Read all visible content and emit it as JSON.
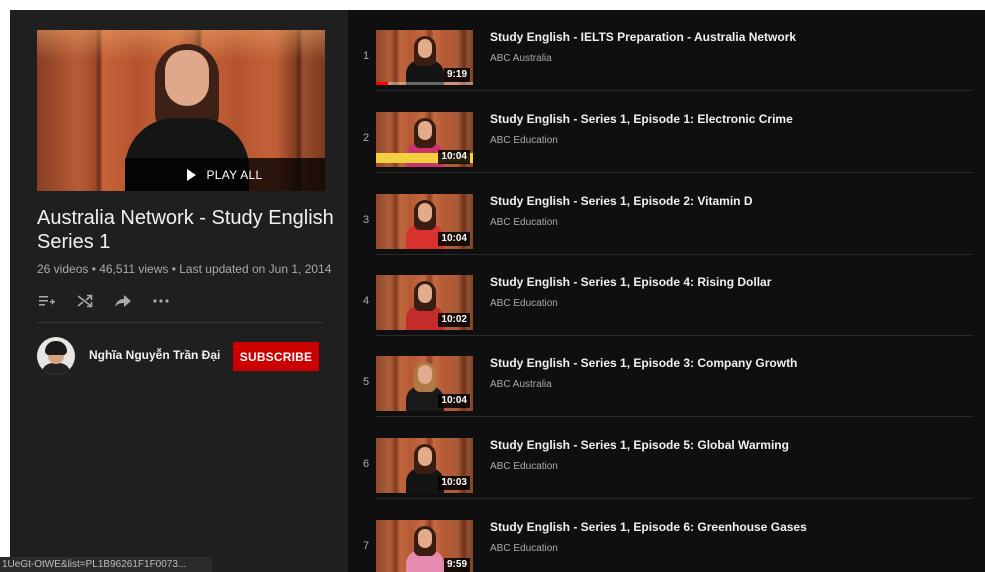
{
  "playlist": {
    "play_all_label": "PLAY ALL",
    "title": "Australia Network - Study English Series 1",
    "stats": "26 videos • 46,511 views • Last updated on Jun 1, 2014",
    "actions": [
      {
        "icon": "add-to-queue-icon"
      },
      {
        "icon": "shuffle-icon"
      },
      {
        "icon": "share-icon"
      },
      {
        "icon": "more-icon"
      }
    ]
  },
  "owner": {
    "name": "Nghĩa Nguyễn Trần Đại",
    "subscribe_label": "SUBSCRIBE"
  },
  "videos": [
    {
      "index": "1",
      "title": "Study English - IELTS Preparation - Australia Network",
      "channel": "ABC Australia",
      "duration": "9:19",
      "watched_fraction": 0.12
    },
    {
      "index": "2",
      "title": "Study English - Series 1, Episode 1: Electronic Crime",
      "channel": "ABC Education",
      "duration": "10:04"
    },
    {
      "index": "3",
      "title": "Study English - Series 1, Episode 2: Vitamin D",
      "channel": "ABC Education",
      "duration": "10:04"
    },
    {
      "index": "4",
      "title": "Study English - Series 1, Episode 4: Rising Dollar",
      "channel": "ABC Education",
      "duration": "10:02"
    },
    {
      "index": "5",
      "title": "Study English - Series 1, Episode 3: Company Growth",
      "channel": "ABC Australia",
      "duration": "10:04"
    },
    {
      "index": "6",
      "title": "Study English - Series 1, Episode 5: Global Warming",
      "channel": "ABC Education",
      "duration": "10:03"
    },
    {
      "index": "7",
      "title": "Study English - Series 1, Episode 6: Greenhouse Gases",
      "channel": "ABC Education",
      "duration": "9:59"
    }
  ],
  "status_url": "1UeGt-OtWE&list=PL1B96261F1F0073...",
  "colors": {
    "accent": "#cc0000",
    "progress": "#ff0000",
    "background": "#0f0f0f",
    "sidebar": "#1f1f1f"
  }
}
